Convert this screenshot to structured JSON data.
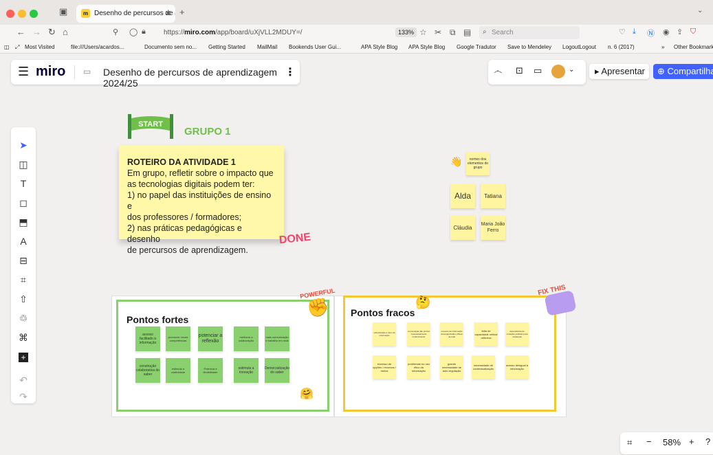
{
  "browser": {
    "tab_title": "Desenho de percursos de apren",
    "url_host": "miro.com",
    "url_prefix": "https://",
    "url_suffix": "/app/board/uXjVLL2MDUY=/",
    "zoom": "133%",
    "search_placeholder": "Search"
  },
  "bookmarks": [
    "Most Visited",
    "file:///Users/acardos...",
    "Documento sem no...",
    "Getting Started",
    "MailMail",
    "Bookends User Gui...",
    "APA Style Blog",
    "APA Style Blog",
    "Google Tradutor",
    "Save to Mendeley",
    "LogoutLogout",
    "n. 6 (2017)",
    "Other Bookmarks"
  ],
  "miro": {
    "logo": "miro",
    "board_title": "Desenho de percursos de aprendizagem 2024/25",
    "present_label": "Apresentar",
    "share_label": "Compartilhar",
    "zoom_level": "58%"
  },
  "canvas": {
    "start_label": "START",
    "group_title": "GRUPO 1",
    "instructions": {
      "heading": "ROTEIRO DA ATIVIDADE 1",
      "lines": [
        "Em grupo, refletir sobre o impacto que",
        "as tecnologias digitais podem ter:",
        "1) no papel das instituições de ensino e",
        "dos professores / formadores;",
        "2) nas práticas pedagógicas e desenho",
        "de percursos de aprendizagem."
      ]
    },
    "done_label": "DONE",
    "members_note": "nomes dos elementos do grupo",
    "members": [
      "Alda",
      "Tatiana",
      "Cláudia",
      "Maria João Ferro"
    ],
    "fortes": {
      "title": "Pontos fortes",
      "sticker": "POWERFUL",
      "notes": [
        "acesso facilitado à informação",
        "promover novas competências",
        "potenciar a reflexão",
        "melhorar a colaboração",
        "mais comunicação e trabalho em rede",
        "construção colaborativa do saber",
        "estimula a criatividade",
        "Potencia a flexibilidade",
        "estimula a inovação",
        "Democratização do saber"
      ]
    },
    "fracos": {
      "title": "Pontos fracos",
      "sticker": "FIX THIS",
      "notes": [
        "sobrelotação e risco da informação",
        "a tecnologia não produz necessariamente conhecimento",
        "excesso de informação desorganizada e difusa na rede",
        "falta de capacidade crítica/ reflexiva",
        "dependência de vontades políticas para mudanças",
        "excesso de opções / recursos / meios",
        "problemas no uso ético da informação",
        "grande necessidade de auto-regulação",
        "necessidade de contextualização",
        "acesso desigual à informação"
      ]
    }
  }
}
